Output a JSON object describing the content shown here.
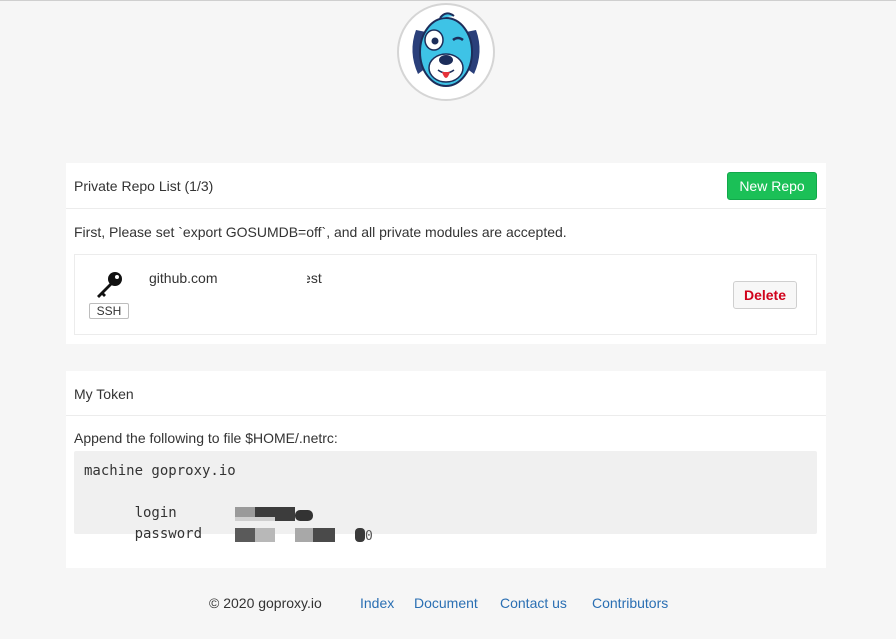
{
  "logo": {
    "icon": "dog-mascot-logo"
  },
  "repos_card": {
    "title": "Private Repo List (1/3)",
    "new_button": "New Repo",
    "note": "First, Please set `export GOSUMDB=off`, and all private modules are accepted.",
    "items": [
      {
        "icon": "key-icon",
        "badge": "SSH",
        "name_prefix": "github.com",
        "name_suffix": "/test",
        "delete_label": "Delete"
      }
    ]
  },
  "token_card": {
    "title": "My Token",
    "instruction": "Append the following to file $HOME/.netrc:",
    "lines": [
      "machine goproxy.io",
      "login",
      "password"
    ]
  },
  "footer": {
    "copyright": "© 2020 goproxy.io",
    "links": [
      "Index",
      "Document",
      "Contact us",
      "Contributors"
    ]
  },
  "colors": {
    "accent_green": "#1bc057",
    "danger_red": "#d0021b",
    "link_blue": "#2a6fb3",
    "background": "#f6f6f6"
  }
}
